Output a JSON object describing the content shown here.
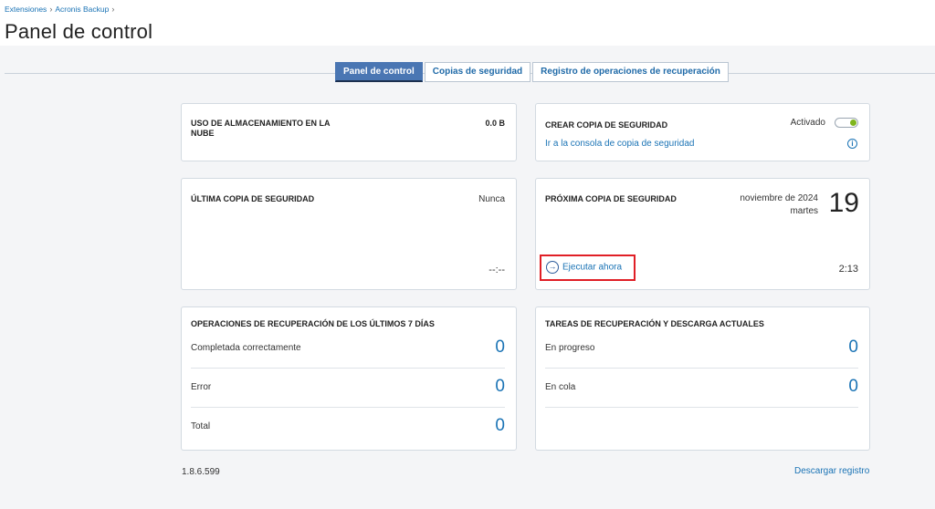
{
  "breadcrumb": {
    "items": [
      "Extensiones",
      "Acronis Backup"
    ],
    "sep": "›"
  },
  "page_title": "Panel de control",
  "tabs": [
    {
      "label": "Panel de control",
      "active": true
    },
    {
      "label": "Copias de seguridad",
      "active": false
    },
    {
      "label": "Registro de operaciones de recuperación",
      "active": false
    }
  ],
  "storage": {
    "title": "USO DE ALMACENAMIENTO EN LA NUBE",
    "value": "0.0 B"
  },
  "create_backup": {
    "title": "CREAR COPIA DE SEGURIDAD",
    "status": "Activado",
    "enabled": true,
    "console_link": "Ir a la consola de copia de seguridad",
    "info_icon": "info-icon"
  },
  "last_backup": {
    "title": "ÚLTIMA COPIA DE SEGURIDAD",
    "value": "Nunca",
    "time": "--:--"
  },
  "next_backup": {
    "title": "PRÓXIMA COPIA DE SEGURIDAD",
    "month_year": "noviembre de 2024",
    "weekday": "martes",
    "day": "19",
    "run_now": "Ejecutar ahora",
    "run_icon": "arrow-right-circle-icon",
    "time": "2:13"
  },
  "recovery_ops": {
    "title": "OPERACIONES DE RECUPERACIÓN DE LOS ÚLTIMOS 7 DÍAS",
    "rows": [
      {
        "label": "Completada correctamente",
        "value": "0"
      },
      {
        "label": "Error",
        "value": "0"
      },
      {
        "label": "Total",
        "value": "0"
      }
    ]
  },
  "current_tasks": {
    "title": "TAREAS DE RECUPERACIÓN Y DESCARGA ACTUALES",
    "rows": [
      {
        "label": "En progreso",
        "value": "0"
      },
      {
        "label": "En cola",
        "value": "0"
      }
    ]
  },
  "footer": {
    "version": "1.8.6.599",
    "download_log": "Descargar registro"
  },
  "colors": {
    "accent": "#1a73b5",
    "tab_active": "#4a76b3",
    "toggle_on": "#7fb51c",
    "highlight_box": "#e01f26"
  }
}
